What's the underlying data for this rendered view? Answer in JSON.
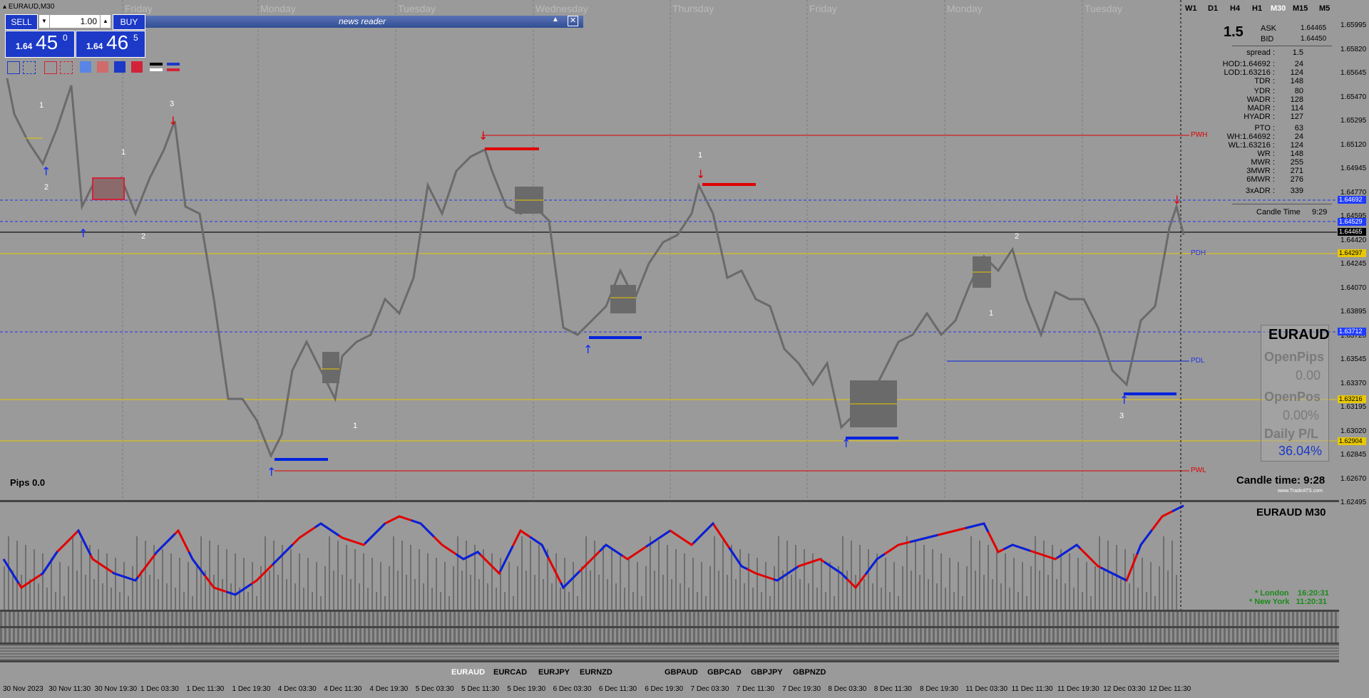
{
  "window": {
    "title": "EURAUD,M30"
  },
  "news_reader": {
    "title": "news reader"
  },
  "trade_panel": {
    "sell_label": "SELL",
    "buy_label": "BUY",
    "lot_value": "1.00",
    "bid_big": "1.64",
    "bid_main": "45",
    "bid_sup": "0",
    "ask_big": "1.64",
    "ask_main": "46",
    "ask_sup": "5"
  },
  "timeframes": [
    "W1",
    "D1",
    "H4",
    "H1",
    "M30",
    "M15",
    "M5"
  ],
  "active_timeframe": "M30",
  "day_labels": [
    "Friday",
    "Monday",
    "Tuesday",
    "Wednesday",
    "Thursday",
    "Friday",
    "Monday",
    "Tuesday"
  ],
  "stats": {
    "spread_big": "1.5",
    "ask_label": "ASK",
    "ask_value": "1.64465",
    "bid_label": "BID",
    "bid_value": "1.64450",
    "rows": [
      {
        "label": "spread :",
        "value": "1.5"
      },
      {
        "label": "HOD:1.64692 :",
        "value": "24"
      },
      {
        "label": "LOD:1.63216 :",
        "value": "124"
      },
      {
        "label": "TDR :",
        "value": "148"
      },
      {
        "label": "YDR :",
        "value": "80"
      },
      {
        "label": "WADR :",
        "value": "128"
      },
      {
        "label": "MADR :",
        "value": "114"
      },
      {
        "label": "HYADR :",
        "value": "127"
      },
      {
        "label": "PTO :",
        "value": "63"
      },
      {
        "label": "WH:1.64692 :",
        "value": "24"
      },
      {
        "label": "WL:1.63216 :",
        "value": "124"
      },
      {
        "label": "WR :",
        "value": "148"
      },
      {
        "label": "MWR :",
        "value": "255"
      },
      {
        "label": "3MWR :",
        "value": "271"
      },
      {
        "label": "6MWR :",
        "value": "276"
      },
      {
        "label": "3xADR :",
        "value": "339"
      }
    ],
    "candle_time_label": "Candle Time",
    "candle_time_value": "9:29"
  },
  "pnl_box": {
    "symbol": "EURAUD",
    "open_pips_label": "OpenPips",
    "open_pips_value": "0.00",
    "open_pos_label": "OpenPos",
    "open_pos_value": "0.00%",
    "daily_pl_label": "Daily P/L",
    "daily_pl_value": "36.04%"
  },
  "candle_time_big": "Candle time:  9:28",
  "watermark": "www.TradeATS.com",
  "pips_label": "Pips 0.0",
  "osc_title": "EURAUD  M30",
  "sessions": {
    "london": "* London    16:20:31",
    "newyork": "* New York   11:20:31"
  },
  "level_labels": {
    "pwh": "PWH",
    "pdh": "PDH",
    "pdl": "PDL",
    "pwl": "PWL"
  },
  "chart_markers": [
    "1",
    "2",
    "3",
    "1",
    "2",
    "1",
    "1",
    "1",
    "2",
    "1",
    "3"
  ],
  "price_axis": [
    "1.65995",
    "1.65820",
    "1.65645",
    "1.65470",
    "1.65295",
    "1.65120",
    "1.64945",
    "1.64770",
    "1.64595",
    "1.64420",
    "1.64245",
    "1.64070",
    "1.63895",
    "1.63720",
    "1.63545",
    "1.63370",
    "1.63195",
    "1.63020",
    "1.62845",
    "1.62670",
    "1.62495"
  ],
  "price_tags": [
    {
      "text": "1.64692",
      "color": "#1f3cff",
      "fg": "#ffffff"
    },
    {
      "text": "1.64529",
      "color": "#1f3cff",
      "fg": "#ffffff"
    },
    {
      "text": "1.64465",
      "color": "#000000",
      "fg": "#ffffff"
    },
    {
      "text": "1.64297",
      "color": "#e8c800",
      "fg": "#000000"
    },
    {
      "text": "1.63712",
      "color": "#1f3cff",
      "fg": "#ffffff"
    },
    {
      "text": "1.63216",
      "color": "#e8c800",
      "fg": "#000000"
    },
    {
      "text": "1.62904",
      "color": "#e8c800",
      "fg": "#000000"
    }
  ],
  "time_axis": [
    "30 Nov 2023",
    "30 Nov 11:30",
    "30 Nov 19:30",
    "1 Dec 03:30",
    "1 Dec 11:30",
    "1 Dec 19:30",
    "4 Dec 03:30",
    "4 Dec 11:30",
    "4 Dec 19:30",
    "5 Dec 03:30",
    "5 Dec 11:30",
    "5 Dec 19:30",
    "6 Dec 03:30",
    "6 Dec 11:30",
    "6 Dec 19:30",
    "7 Dec 03:30",
    "7 Dec 11:30",
    "7 Dec 19:30",
    "8 Dec 03:30",
    "8 Dec 11:30",
    "8 Dec 19:30",
    "11 Dec 03:30",
    "11 Dec 11:30",
    "11 Dec 19:30",
    "12 Dec 03:30",
    "12 Dec 11:30"
  ],
  "symbols": [
    "EURAUD",
    "EURCAD",
    "EURJPY",
    "EURNZD",
    "GBPAUD",
    "GBPCAD",
    "GBPJPY",
    "GBPNZD"
  ],
  "active_symbol": "EURAUD",
  "colors": {
    "background": "#9a9a9a",
    "buy_sell": "#1c39c7",
    "resistance": "#e00000",
    "support": "#0022dd",
    "yellow": "#e8c800"
  }
}
